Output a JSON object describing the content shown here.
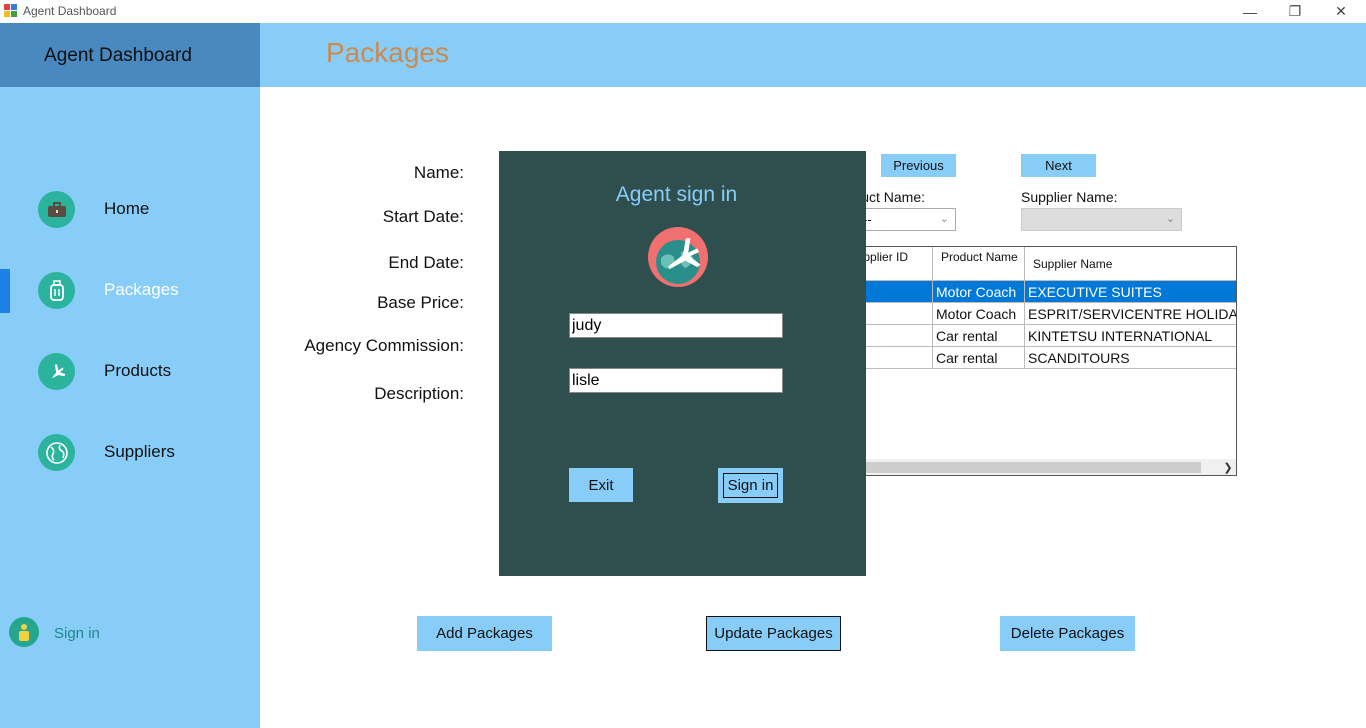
{
  "window": {
    "title": "Agent Dashboard",
    "minimize_glyph": "—",
    "restore_glyph": "❐",
    "close_glyph": "✕"
  },
  "sidebar": {
    "title": "Agent Dashboard",
    "items": [
      {
        "label": "Home",
        "icon": "briefcase-icon"
      },
      {
        "label": "Packages",
        "icon": "luggage-icon",
        "active": true
      },
      {
        "label": "Products",
        "icon": "airplane-icon"
      },
      {
        "label": "Suppliers",
        "icon": "globe-icon"
      }
    ],
    "signin_label": "Sign in"
  },
  "header": {
    "title": "Packages"
  },
  "form": {
    "labels": {
      "name": "Name:",
      "start_date": "Start Date:",
      "end_date": "End Date:",
      "base_price": "Base Price:",
      "agency_commission": "Agency Commission:",
      "description": "Description:"
    }
  },
  "nav": {
    "previous": "Previous",
    "next": "Next"
  },
  "combos": {
    "product_name_label": "Product Name:",
    "product_name_value": "--",
    "supplier_name_label": "Supplier Name:",
    "supplier_name_value": ""
  },
  "grid": {
    "columns": [
      "Product Supplier ID",
      "Product Name",
      "Supplier Name"
    ],
    "rows": [
      {
        "product": "Motor Coach",
        "supplier": "EXECUTIVE SUITES",
        "selected": true
      },
      {
        "product": "Motor Coach",
        "supplier": "ESPRIT/SERVICENTRE HOLIDAYS"
      },
      {
        "product": "Car rental",
        "supplier": "KINTETSU INTERNATIONAL"
      },
      {
        "product": "Car rental",
        "supplier": "SCANDITOURS"
      }
    ]
  },
  "buttons": {
    "add": "Add Packages",
    "update": "Update Packages",
    "delete": "Delete Packages"
  },
  "dialog": {
    "title": "Agent sign in",
    "username": "judy",
    "password": "lisle",
    "exit": "Exit",
    "signin": "Sign in"
  },
  "colors": {
    "sidebar": "#87cdf8",
    "sidebar_header": "#4a88c0",
    "title_accent": "#cd8a4e",
    "dialog_bg": "#2f4f4f",
    "selection": "#0078d7",
    "icon_teal": "#2bb39d"
  }
}
